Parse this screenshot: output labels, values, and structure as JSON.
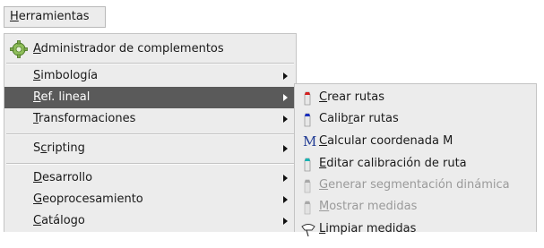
{
  "menubar": {
    "menu_pre": "",
    "menu_key": "H",
    "menu_post": "erramientas"
  },
  "main_menu": {
    "items": [
      {
        "pre": "",
        "key": "A",
        "post": "dministrador de complementos",
        "icon": "gear-plugin-icon"
      },
      {
        "pre": "",
        "key": "S",
        "post": "imbología"
      },
      {
        "pre": "",
        "key": "R",
        "post": "ef. lineal"
      },
      {
        "pre": "",
        "key": "T",
        "post": "ransformaciones"
      },
      {
        "pre": "S",
        "key": "c",
        "post": "ripting"
      },
      {
        "pre": "",
        "key": "D",
        "post": "esarrollo"
      },
      {
        "pre": "",
        "key": "G",
        "post": "eoprocesamiento"
      },
      {
        "pre": "",
        "key": "C",
        "post": "atálogo"
      }
    ]
  },
  "sub_menu": {
    "items": [
      {
        "pre": "",
        "key": "C",
        "post": "rear rutas",
        "icon": "create-route-icon",
        "color": "#d62020"
      },
      {
        "pre": "Calib",
        "key": "r",
        "post": "ar rutas",
        "icon": "calibrate-route-icon",
        "color": "#1a2fbf"
      },
      {
        "pre": "",
        "key": "C",
        "post": "alcular coordenada M",
        "icon": "m-coordinate-icon",
        "glyph": "M"
      },
      {
        "pre": "",
        "key": "E",
        "post": "ditar calibración de ruta",
        "icon": "edit-calibration-icon",
        "color": "#17b3b3"
      },
      {
        "pre": "",
        "key": "G",
        "post": "enerar segmentación dinámica",
        "icon": "dynamic-segmentation-icon",
        "disabled": true
      },
      {
        "pre": "",
        "key": "M",
        "post": "ostrar medidas",
        "icon": "show-measures-icon",
        "disabled": true
      },
      {
        "pre": "",
        "key": "L",
        "post": "impiar medidas",
        "icon": "clear-measures-icon"
      }
    ]
  }
}
